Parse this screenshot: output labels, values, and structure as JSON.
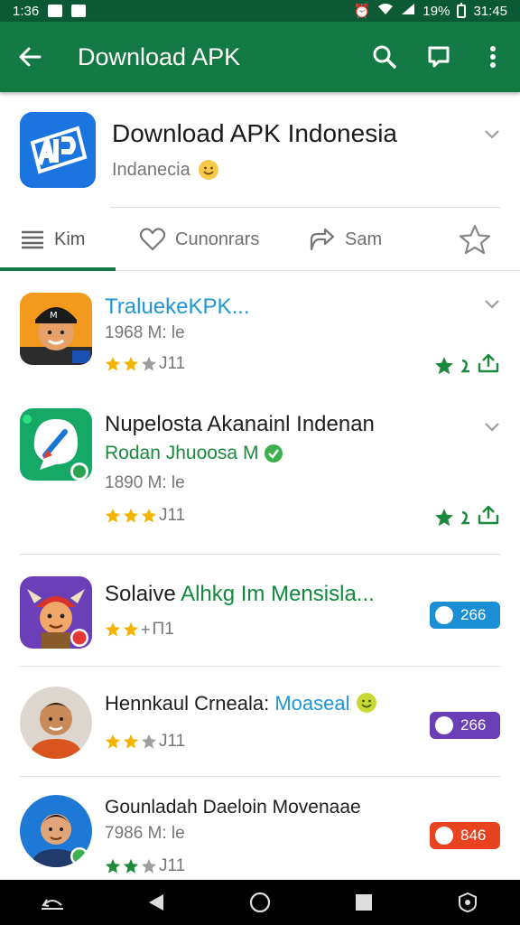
{
  "status": {
    "time_left": "1:36",
    "battery": "19%",
    "time_right": "31:45"
  },
  "appbar": {
    "title": "Download APK"
  },
  "header": {
    "title": "Download APK Indonesia",
    "subtitle": "Indanecia"
  },
  "tabs": [
    {
      "label": "Kim",
      "icon": "list-icon"
    },
    {
      "label": "Cunonrars",
      "icon": "heart-icon"
    },
    {
      "label": "Sam",
      "icon": "share-icon"
    },
    {
      "label": "",
      "icon": "star-icon"
    }
  ],
  "apps": [
    {
      "name": "TraluekeKPK...",
      "meta": "1968 M: le",
      "rating_text": "J11"
    },
    {
      "name": "Nupelosta Akanainl Indenan",
      "developer": "Rodan Jhuoosa M",
      "meta": "1890 M: le",
      "rating_text": "J11"
    },
    {
      "name_black": "Solaive ",
      "name_green": "Alhkg Im Mensisla...",
      "rating_text": "Π1",
      "badge": "266",
      "badge_color": "#1a8fd6"
    },
    {
      "name_black": "Hennkaul Crneala: ",
      "name_blue": "Moaseal",
      "rating_text": "J11",
      "badge": "266",
      "badge_color": "#6a3fb5"
    },
    {
      "name": "Gounladah Daeloin Movenaae",
      "meta": "7986 M: le",
      "rating_text": "J11",
      "badge": "846",
      "badge_color": "#e8431f"
    }
  ],
  "colors": {
    "primary": "#137a45",
    "status": "#0b5a35",
    "star": "#f5b301",
    "green_star": "#1b8a3a"
  }
}
